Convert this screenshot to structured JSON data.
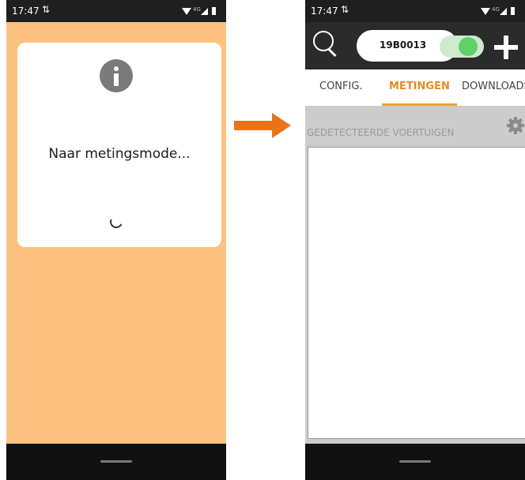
{
  "left_phone": {
    "status": {
      "time": "17:47",
      "sync_icon": "sync-icon",
      "network": "4G"
    },
    "dialog": {
      "icon": "info-icon",
      "message": "Naar metingsmode...",
      "spinner": "loading-spinner"
    },
    "background_color": "#fdc27f"
  },
  "arrow": {
    "color": "#e9731a",
    "icon": "arrow-right-icon"
  },
  "right_phone": {
    "status": {
      "time": "17:47",
      "sync_icon": "sync-icon",
      "network": "4G"
    },
    "toolbar": {
      "search_icon": "search-icon",
      "device_selected": "19B0013",
      "toggle_on": true,
      "add_icon": "plus-icon"
    },
    "tabs": [
      {
        "label": "CONFIG.",
        "active": false
      },
      {
        "label": "METINGEN",
        "active": true
      },
      {
        "label": "DOWNLOADS",
        "active": false
      }
    ],
    "section": {
      "title": "GEDETECTEERDE VOERTUIGEN",
      "settings_icon": "gear-icon",
      "items": []
    },
    "accent_color": "#e98b1d"
  }
}
